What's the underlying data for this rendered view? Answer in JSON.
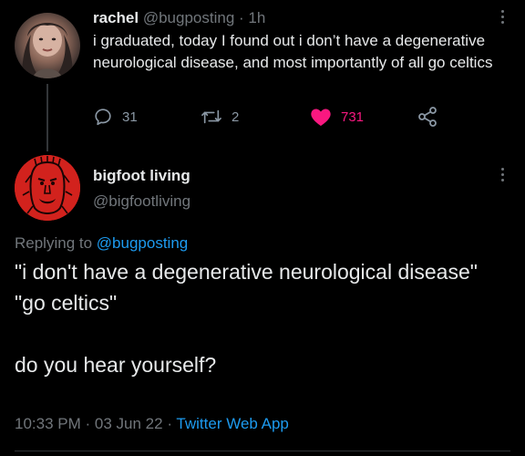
{
  "parent_tweet": {
    "display_name": "rachel",
    "handle": "@bugposting",
    "separator": "·",
    "time": "1h",
    "text": "i graduated, today I found out i don’t have a degenerative neurological disease, and most importantly of all go celtics",
    "actions": {
      "reply": {
        "icon": "reply-bubble-icon",
        "count": "31"
      },
      "retweet": {
        "icon": "retweet-icon",
        "count": "2"
      },
      "like": {
        "icon": "heart-filled-icon",
        "count": "731",
        "color": "#f91880"
      },
      "share": {
        "icon": "share-icon"
      }
    }
  },
  "reply_tweet": {
    "display_name": "bigfoot living",
    "handle": "@bigfootliving",
    "replying_to_prefix": "Replying to",
    "replying_to_handle": "@bugposting",
    "lines": [
      "\"i don't have a degenerative neurological disease\"",
      "\"go celtics\"",
      "do you hear yourself?"
    ],
    "time": "10:33 PM",
    "date": "03 Jun 22",
    "separator": "·",
    "source": "Twitter Web App"
  },
  "colors": {
    "background": "#000000",
    "text": "#e7e9ea",
    "muted": "#71767b",
    "link": "#1d9bf0",
    "like": "#f91880",
    "bigfoot_avatar": "#d2221d"
  }
}
